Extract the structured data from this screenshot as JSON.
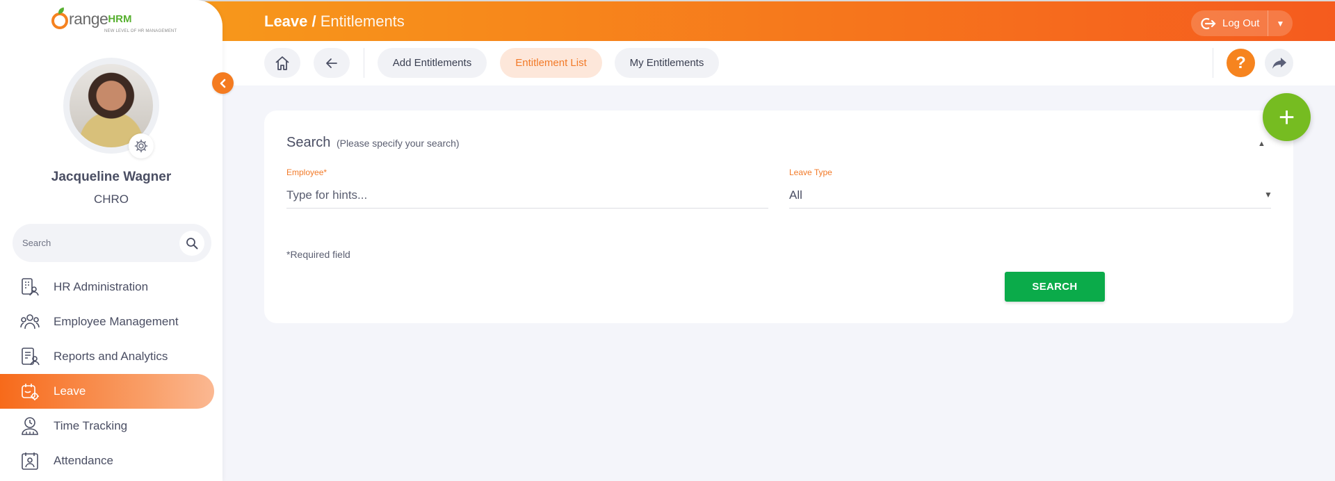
{
  "app": {
    "logo_text": "range",
    "logo_hrm": "HRM",
    "logo_tagline": "NEW LEVEL OF HR MANAGEMENT"
  },
  "header": {
    "module": "Leave",
    "separator": " / ",
    "page": "Entitlements",
    "logout_label": "Log Out"
  },
  "user": {
    "name": "Jacqueline Wagner",
    "role": "CHRO"
  },
  "sidebar": {
    "search_placeholder": "Search",
    "items": [
      {
        "label": "HR Administration",
        "icon": "hr-admin-icon",
        "active": false
      },
      {
        "label": "Employee Management",
        "icon": "employee-management-icon",
        "active": false
      },
      {
        "label": "Reports and Analytics",
        "icon": "reports-icon",
        "active": false
      },
      {
        "label": "Leave",
        "icon": "leave-icon",
        "active": true
      },
      {
        "label": "Time Tracking",
        "icon": "time-tracking-icon",
        "active": false
      },
      {
        "label": "Attendance",
        "icon": "attendance-icon",
        "active": false
      }
    ]
  },
  "toolbar": {
    "tabs": [
      {
        "label": "Add Entitlements",
        "active": false
      },
      {
        "label": "Entitlement List",
        "active": true
      },
      {
        "label": "My Entitlements",
        "active": false
      }
    ],
    "help_label": "?"
  },
  "search_card": {
    "title": "Search",
    "subtitle": "(Please specify your search)",
    "employee_label": "Employee*",
    "employee_placeholder": "Type for hints...",
    "employee_value": "",
    "leave_type_label": "Leave Type",
    "leave_type_value": "All",
    "required_note": "*Required field",
    "submit_label": "SEARCH"
  },
  "fab_label": "+",
  "colors": {
    "brand_orange": "#f7871b",
    "accent_green": "#0bab4a",
    "fab_green": "#76bc21"
  }
}
